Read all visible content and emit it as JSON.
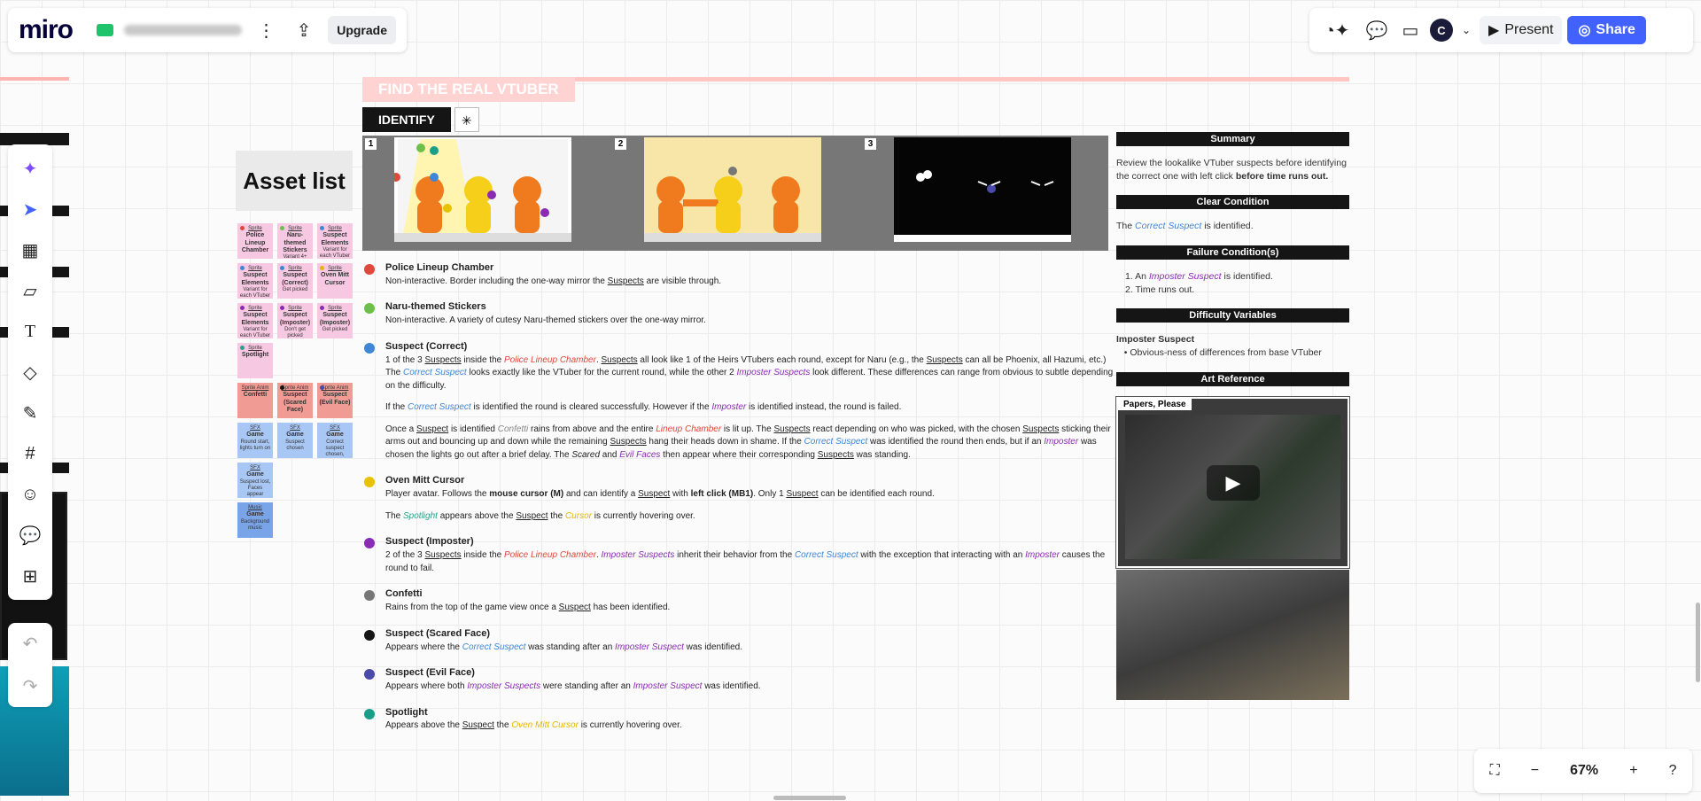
{
  "app": {
    "logo": "miro",
    "upgrade": "Upgrade",
    "present": "Present",
    "share": "Share",
    "avatar": "C"
  },
  "zoom": {
    "level": "67%"
  },
  "asset_list": {
    "title": "Asset list",
    "stickies": [
      {
        "t": "Sprite",
        "b": "Police Lineup Chamber",
        "c": "#f7c8e2",
        "dot": "#e0483e"
      },
      {
        "t": "Sprite",
        "b": "Naru-themed Stickers",
        "s": "Variant 4+",
        "c": "#f7c8e2",
        "dot": "#6cc04a"
      },
      {
        "t": "Sprite",
        "b": "Suspect Elements",
        "s": "Variant for each VTuber",
        "c": "#f7c8e2",
        "dot": "#3f86d6"
      },
      {
        "t": "Sprite",
        "b": "Suspect Elements",
        "s": "Variant for each VTuber",
        "c": "#f7c8e2",
        "dot": "#3f86d6"
      },
      {
        "t": "Sprite",
        "b": "Suspect (Correct)",
        "s": "Get picked",
        "c": "#f7c8e2",
        "dot": "#3f86d6"
      },
      {
        "t": "Sprite",
        "b": "Oven Mitt Cursor",
        "c": "#f7c8e2",
        "dot": "#e6b700"
      },
      {
        "t": "Sprite",
        "b": "Suspect Elements",
        "s": "Variant for each VTuber",
        "c": "#f7c8e2",
        "dot": "#8a2bb5"
      },
      {
        "t": "Sprite",
        "b": "Suspect (Imposter)",
        "s": "Don't get picked",
        "c": "#f7c8e2",
        "dot": "#8a2bb5"
      },
      {
        "t": "Sprite",
        "b": "Suspect (Imposter)",
        "s": "Get picked",
        "c": "#f7c8e2",
        "dot": "#8a2bb5"
      },
      {
        "t": "Sprite",
        "b": "Spotlight",
        "c": "#f7c8e2",
        "dot": "#2aa08a"
      },
      {
        "t": "",
        "b": "",
        "c": "transparent",
        "dot": ""
      },
      {
        "t": "",
        "b": "",
        "c": "transparent",
        "dot": ""
      },
      {
        "t": "Sprite Anim",
        "b": "Confetti",
        "c": "#f19b95",
        "dot": ""
      },
      {
        "t": "Sprite Anim",
        "b": "Suspect (Scared Face)",
        "c": "#f19b95",
        "dot": "#151515"
      },
      {
        "t": "Sprite Anim",
        "b": "Suspect (Evil Face)",
        "c": "#f19b95",
        "dot": "#4a4aa8"
      },
      {
        "t": "SFX",
        "b": "Game",
        "s": "Round start, lights turn on",
        "c": "#a9c7f5",
        "dot": ""
      },
      {
        "t": "SFX",
        "b": "Game",
        "s": "Suspect chosen",
        "c": "#a9c7f5",
        "dot": ""
      },
      {
        "t": "SFX",
        "b": "Game",
        "s": "Correct suspect chosen, lights turn off",
        "c": "#a9c7f5",
        "dot": ""
      },
      {
        "t": "SFX",
        "b": "Game",
        "s": "Suspect lost, Faces appear",
        "c": "#a9c7f5",
        "dot": ""
      },
      {
        "t": "",
        "b": "",
        "c": "transparent",
        "dot": ""
      },
      {
        "t": "",
        "b": "",
        "c": "transparent",
        "dot": ""
      },
      {
        "t": "Music",
        "b": "Game",
        "s": "Background music",
        "c": "#7aa4e8",
        "dot": ""
      }
    ]
  },
  "doc": {
    "title": "FIND THE REAL VTUBER",
    "tab": "IDENTIFY",
    "panels": [
      "1",
      "2",
      "3"
    ],
    "items": [
      {
        "color": "#e0483e",
        "title": "Police Lineup Chamber",
        "html": "Non-interactive. Border including the one-way mirror the <span class='u'>Suspects</span> are visible through."
      },
      {
        "color": "#6cc04a",
        "title": "Naru-themed Stickers",
        "html": "Non-interactive. A variety of cutesy Naru-themed stickers over the one-way mirror."
      },
      {
        "color": "#3f86d6",
        "title": "Suspect (Correct)",
        "html": "1 of the 3 <span class='u'>Suspects</span> inside the <span class='red'>Police Lineup Chamber</span>. <span class='u'>Suspects</span> all look like 1 of the Heirs VTubers each round, except for Naru (e.g., the <span class='u'>Suspects</span> can all be Phoenix, all Hazumi, etc.) The <span class='blue'>Correct Suspect</span> looks exactly like the VTuber for the current round, while the other 2 <span class='purple'>Imposter Suspects</span> look different. These differences can range from obvious to subtle depending on the difficulty.<div class='sub'>If the <span class='blue'>Correct Suspect</span> is identified the round is cleared successfully. However if the <span class='purple'>Imposter</span> is identified instead, the round is failed.</div><div class='sub'>Once a <span class='u'>Suspect</span> is identified <span class='gray'>Confetti</span> rains from above and the entire <span class='red'>Lineup Chamber</span> is lit up. The <span class='u'>Suspects</span> react depending on who was picked, with the chosen <span class='u'>Suspects</span> sticking their arms out and bouncing up and down while the remaining <span class='u'>Suspects</span> hang their heads down in shame. If the <span class='blue'>Correct Suspect</span> was identified the round then ends, but if an <span class='purple'>Imposter</span> was chosen the lights go out after a brief delay. The <i>Scared</i> and <span class='purple'>Evil Faces</span> then appear where their corresponding <span class='u'>Suspects</span> was standing.</div>"
      },
      {
        "color": "#e6c200",
        "title": "Oven Mitt Cursor",
        "html": "Player avatar. Follows the <b>mouse cursor (M)</b> and can identify a <span class='u'>Suspect</span> with <b>left click (MB1)</b>. Only 1 <span class='u'>Suspect</span> can be identified each round.<div class='sub'>The <span class='green'>Spotlight</span> appears above the <span class='u'>Suspect</span> the <span class='yellow'>Cursor</span> is currently hovering over.</div>"
      },
      {
        "color": "#8a2bb5",
        "title": "Suspect (Imposter)",
        "html": "2 of the 3 <span class='u'>Suspects</span> inside the <span class='red'>Police Lineup Chamber</span>. <span class='purple'>Imposter Suspects</span> inherit their behavior from the <span class='blue'>Correct Suspect</span> with the exception that interacting with an <span class='purple'>Imposter</span> causes the round to fail."
      },
      {
        "color": "#777777",
        "title": "Confetti",
        "html": "Rains from the top of the game view once a <span class='u'>Suspect</span> has been identified."
      },
      {
        "color": "#151515",
        "title": "Suspect (Scared Face)",
        "html": "Appears where the <span class='blue'>Correct Suspect</span> was standing after an <span class='purple'>Imposter Suspect</span> was identified."
      },
      {
        "color": "#4a4aa8",
        "title": "Suspect (Evil Face)",
        "html": "Appears where both <span class='purple'>Imposter Suspects</span> were standing after an <span class='purple'>Imposter Suspect</span> was identified."
      },
      {
        "color": "#1a9e8a",
        "title": "Spotlight",
        "html": "Appears above the <span class='u'>Suspect</span> the <span class='yellow'>Oven Mitt Cursor</span> is currently hovering over."
      }
    ]
  },
  "side": {
    "summary_h": "Summary",
    "summary_html": "Review the lookalike VTuber suspects before identifying the correct one with left click <b>before time runs out.</b>",
    "clear_h": "Clear Condition",
    "clear_html": "The <span class='blue'>Correct Suspect</span> is identified.",
    "fail_h": "Failure Condition(s)",
    "fail_html": "1. An <span class='purple'>Imposter Suspect</span> is identified.<br>2. Time runs out.",
    "diff_h": "Difficulty Variables",
    "diff_html": "<b>Imposter Suspect</b><br>&nbsp;&nbsp;&nbsp;• Obvious-ness of differences from base VTuber",
    "art_h": "Art Reference",
    "art_label": "Papers, Please"
  }
}
